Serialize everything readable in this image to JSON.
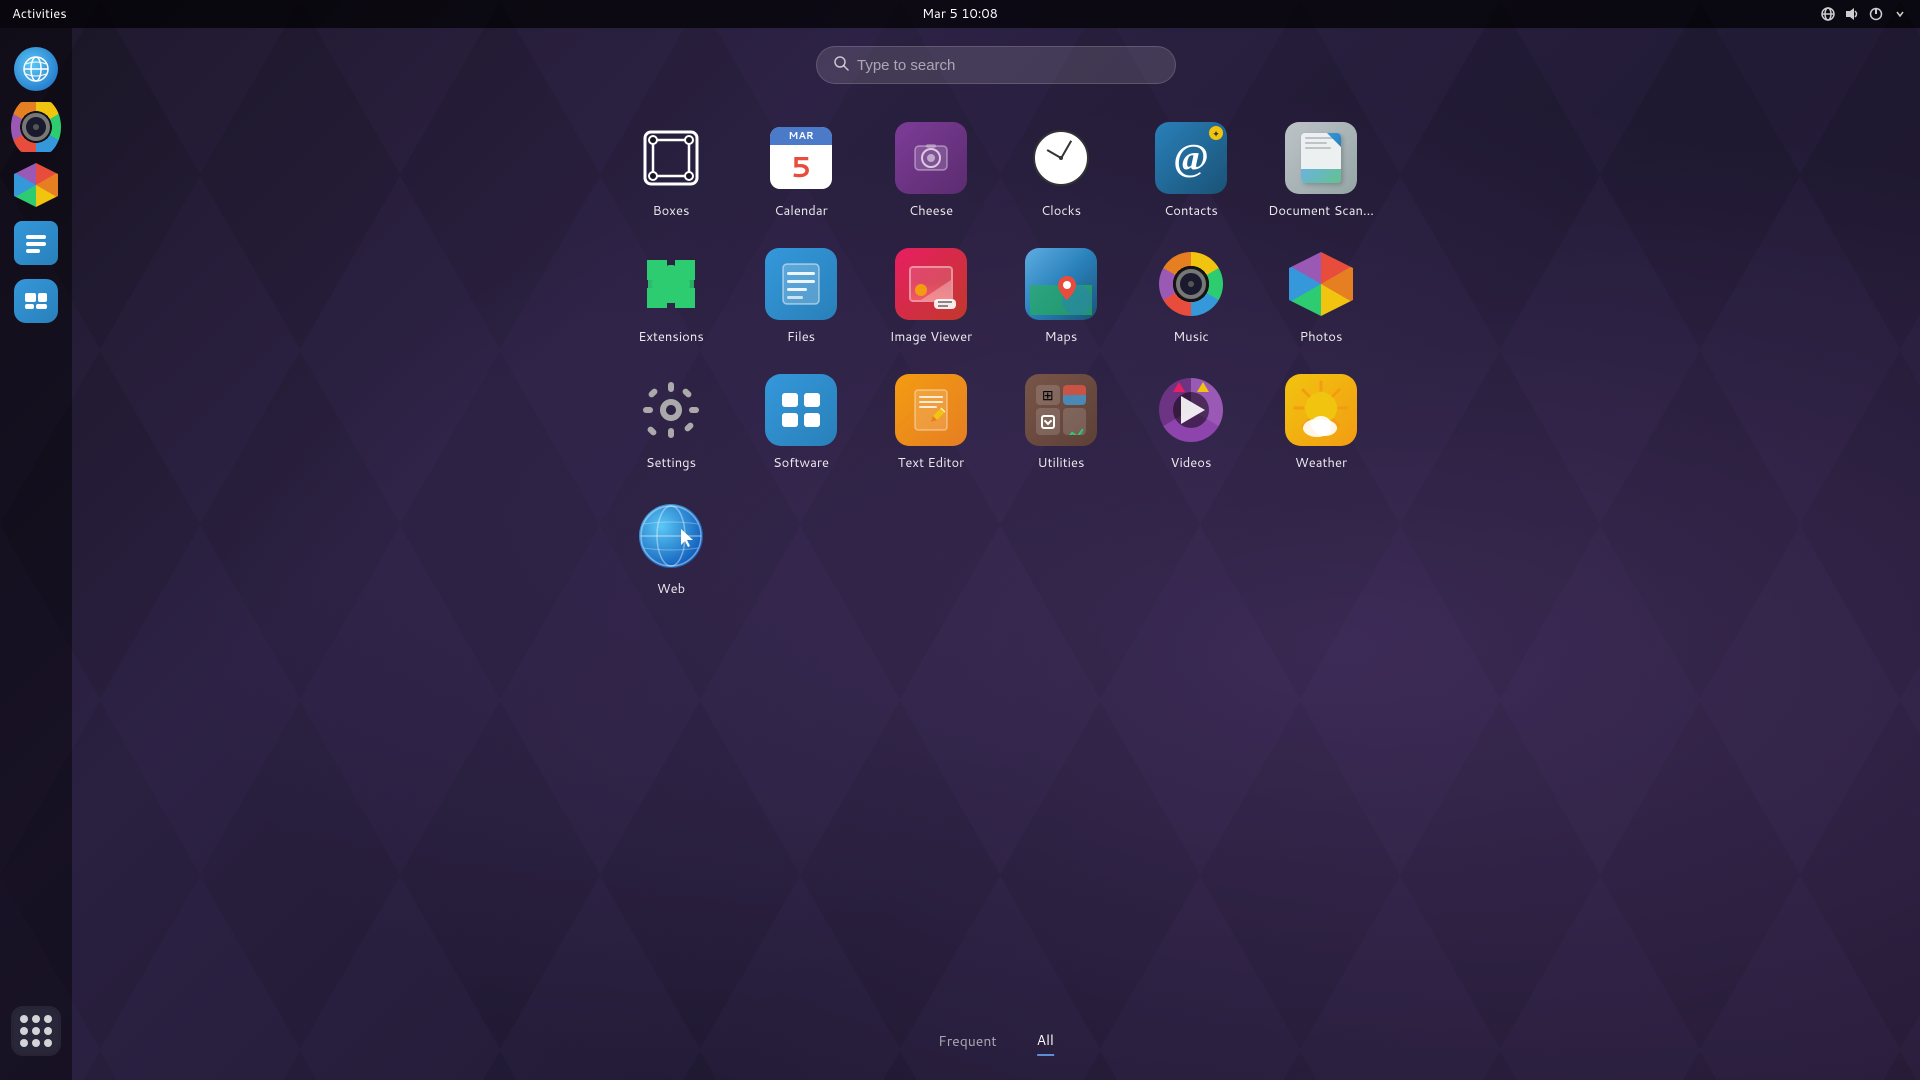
{
  "topbar": {
    "activities_label": "Activities",
    "datetime": "Mar 5  10:08"
  },
  "search": {
    "placeholder": "Type to search"
  },
  "sidebar": {
    "items": [
      {
        "id": "web-browser",
        "label": "Web Browser"
      },
      {
        "id": "music",
        "label": "Music"
      },
      {
        "id": "photos",
        "label": "Photos"
      },
      {
        "id": "files",
        "label": "Files"
      },
      {
        "id": "software",
        "label": "Software Center"
      },
      {
        "id": "app-drawer",
        "label": "App Drawer"
      }
    ]
  },
  "apps": {
    "rows": [
      [
        {
          "id": "boxes",
          "label": "Boxes"
        },
        {
          "id": "calendar",
          "label": "Calendar"
        },
        {
          "id": "cheese",
          "label": "Cheese"
        },
        {
          "id": "clocks",
          "label": "Clocks"
        },
        {
          "id": "contacts",
          "label": "Contacts"
        },
        {
          "id": "docscan",
          "label": "Document Scan..."
        }
      ],
      [
        {
          "id": "extensions",
          "label": "Extensions"
        },
        {
          "id": "files",
          "label": "Files"
        },
        {
          "id": "imageviewer",
          "label": "Image Viewer"
        },
        {
          "id": "maps",
          "label": "Maps"
        },
        {
          "id": "music",
          "label": "Music"
        },
        {
          "id": "photos",
          "label": "Photos"
        }
      ],
      [
        {
          "id": "settings",
          "label": "Settings"
        },
        {
          "id": "software",
          "label": "Software"
        },
        {
          "id": "texteditor",
          "label": "Text Editor"
        },
        {
          "id": "utilities",
          "label": "Utilities"
        },
        {
          "id": "videos",
          "label": "Videos"
        },
        {
          "id": "weather",
          "label": "Weather"
        }
      ],
      [
        {
          "id": "web",
          "label": "Web"
        },
        null,
        null,
        null,
        null,
        null
      ]
    ]
  },
  "tabs": {
    "frequent": "Frequent",
    "all": "All"
  }
}
